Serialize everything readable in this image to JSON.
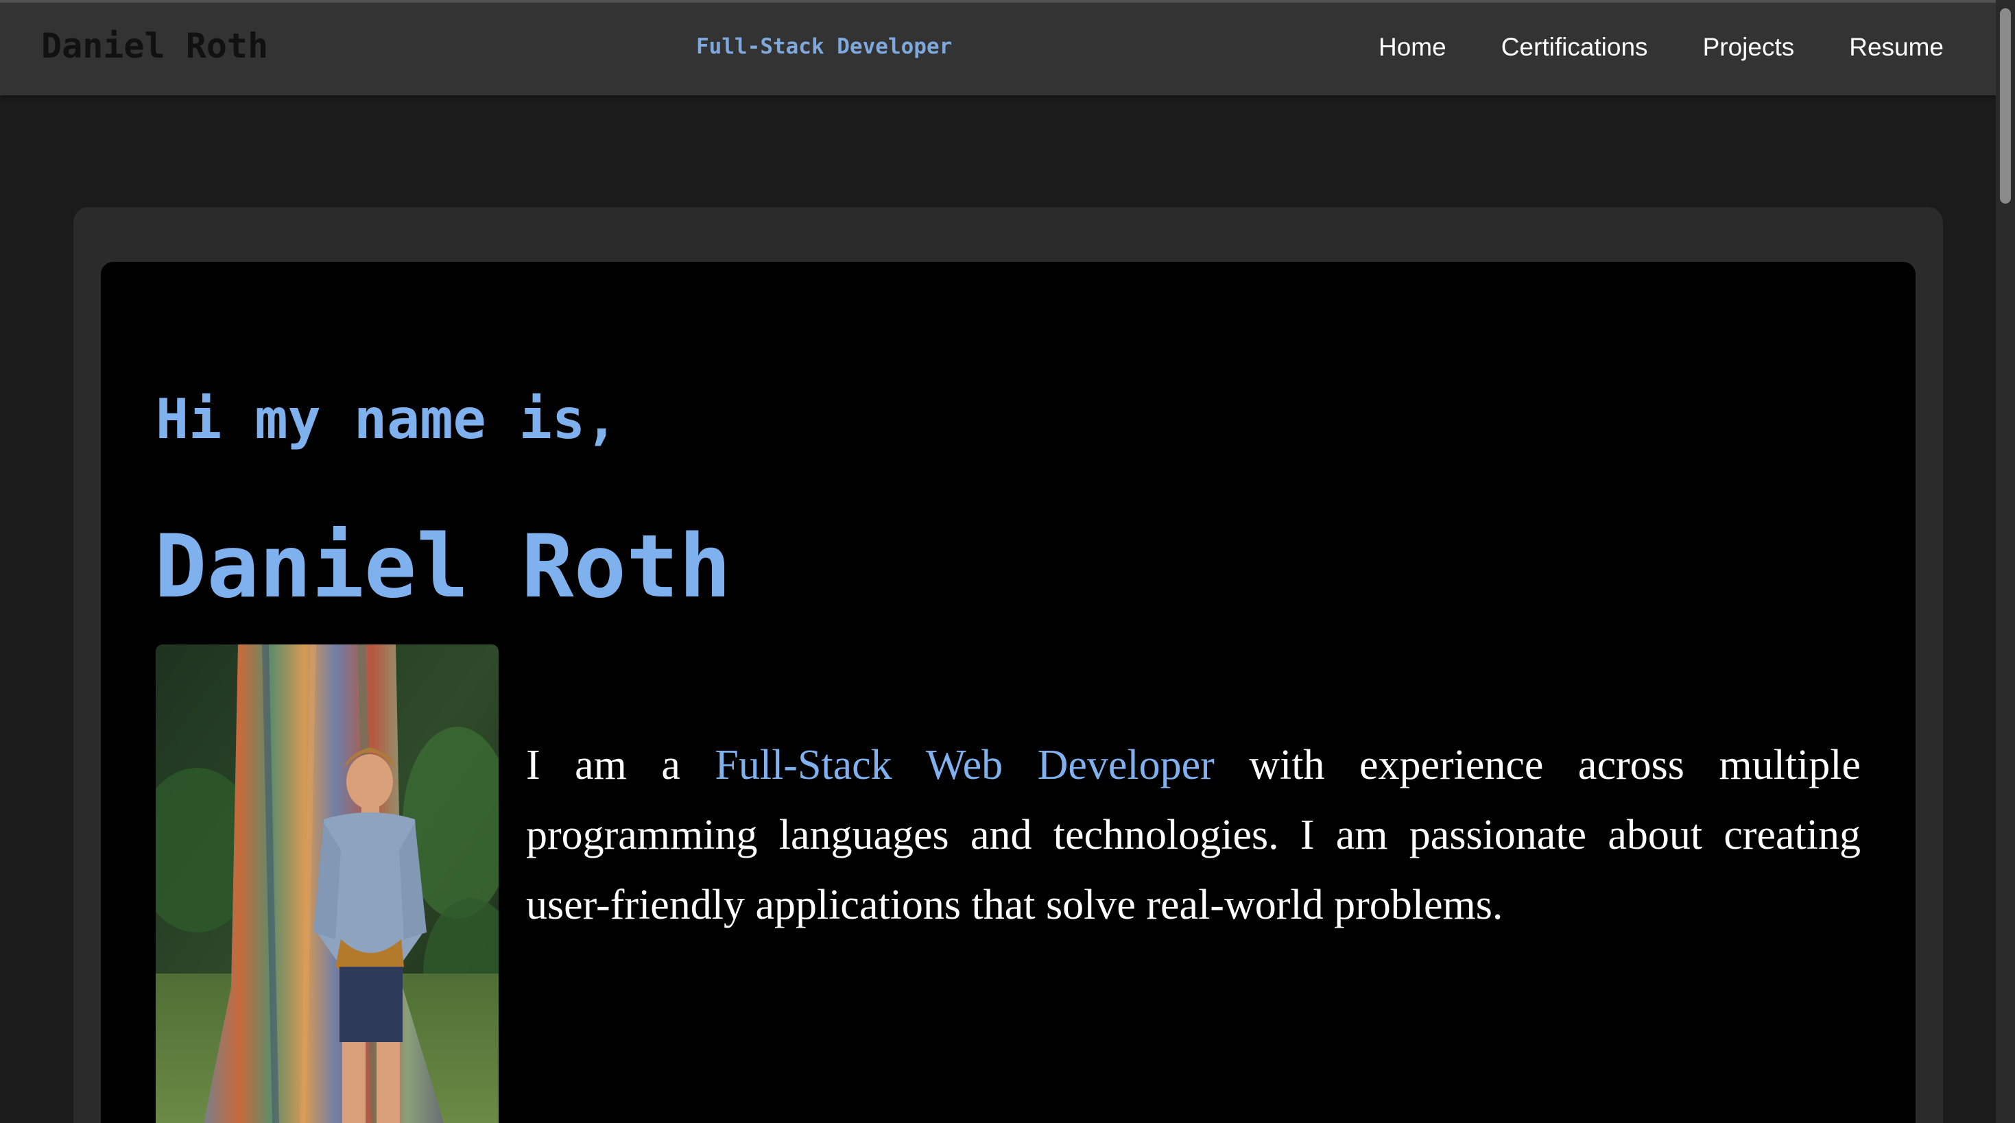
{
  "navbar": {
    "brand": "Daniel Roth",
    "tagline": "Full-Stack Developer",
    "links": [
      "Home",
      "Certifications",
      "Projects",
      "Resume"
    ]
  },
  "hero": {
    "greeting": "Hi my name is,",
    "name": "Daniel Roth",
    "bio_prefix": "I am a ",
    "bio_highlight": "Full-Stack Web Developer",
    "bio_suffix": " with experience across multiple programming languages and technologies. I am passionate about creating user-friendly applications that solve real-world problems."
  },
  "colors": {
    "accent": "#7fb1ee",
    "nav_background": "#333333",
    "page_background": "#1b1b1b",
    "card_background": "#000000"
  }
}
